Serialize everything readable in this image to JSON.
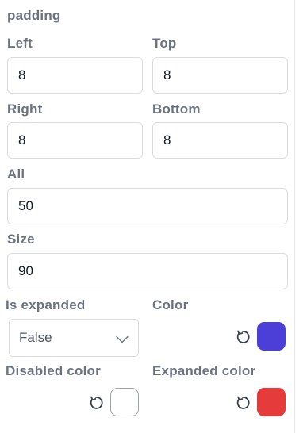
{
  "section": {
    "title": "padding"
  },
  "fields": {
    "left": {
      "label": "Left",
      "value": "8"
    },
    "top": {
      "label": "Top",
      "value": "8"
    },
    "right": {
      "label": "Right",
      "value": "8"
    },
    "bottom": {
      "label": "Bottom",
      "value": "8"
    },
    "all": {
      "label": "All",
      "value": "50"
    },
    "size": {
      "label": "Size",
      "value": "90"
    }
  },
  "is_expanded": {
    "label": "Is expanded",
    "value": "False"
  },
  "colors": {
    "color": {
      "label": "Color",
      "value": "#4c3fd8"
    },
    "disabled_color": {
      "label": "Disabled color",
      "value": "#ffffff"
    },
    "expanded_color": {
      "label": "Expanded color",
      "value": "#e53b3b"
    }
  },
  "icons": {
    "reset": "reset-icon",
    "dropdown": "chevron-down-icon"
  }
}
